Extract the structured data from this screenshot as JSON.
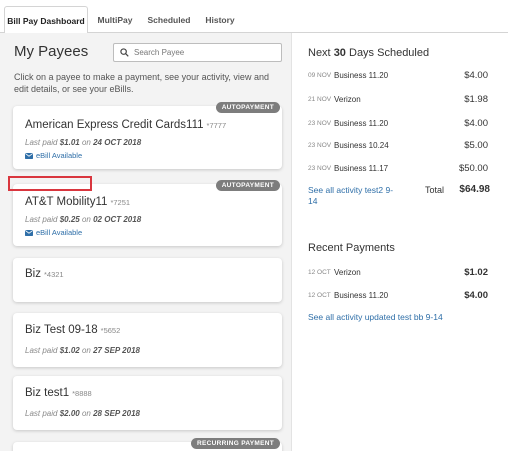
{
  "tabs": [
    {
      "label": "Bill Pay Dashboard",
      "active": true
    },
    {
      "label": "MultiPay",
      "active": false
    },
    {
      "label": "Scheduled",
      "active": false
    },
    {
      "label": "History",
      "active": false
    }
  ],
  "payees": {
    "title": "My Payees",
    "search_placeholder": "Search Payee",
    "intro": "Click on a payee to make a payment, see your activity, view and edit details, or see your eBills.",
    "cards": [
      {
        "name": "American Express Credit Cards111",
        "acct": "*7777",
        "badge": "AUTOPAYMENT",
        "last_paid_prefix": "Last paid",
        "amount": "$1.01",
        "on": "on",
        "date": "24 OCT 2018",
        "ebill": "eBill Available"
      },
      {
        "name": "AT&T Mobility11",
        "acct": "*7251",
        "badge": "AUTOPAYMENT",
        "last_paid_prefix": "Last paid",
        "amount": "$0.25",
        "on": "on",
        "date": "02 OCT 2018",
        "ebill": "eBill Available"
      },
      {
        "name": "Biz",
        "acct": "*4321"
      },
      {
        "name": "Biz Test 09-18",
        "acct": "*5652",
        "last_paid_prefix": "Last paid",
        "amount": "$1.02",
        "on": "on",
        "date": "27 SEP 2018"
      },
      {
        "name": "Biz test1",
        "acct": "*8888",
        "last_paid_prefix": "Last paid",
        "amount": "$2.00",
        "on": "on",
        "date": "28 SEP 2018"
      },
      {
        "badge": "RECURRING PAYMENT"
      }
    ]
  },
  "scheduled": {
    "title_prefix": "Next",
    "title_bold": "30",
    "title_suffix": "Days Scheduled",
    "rows": [
      {
        "date": "09 NOV",
        "name": "Business 11.20",
        "amount": "$4.00"
      },
      {
        "date": "21 NOV",
        "name": "Verizon",
        "amount": "$1.98"
      },
      {
        "date": "23 NOV",
        "name": "Business 11.20",
        "amount": "$4.00"
      },
      {
        "date": "23 NOV",
        "name": "Business 10.24",
        "amount": "$5.00"
      },
      {
        "date": "23 NOV",
        "name": "Business 11.17",
        "amount": "$50.00"
      }
    ],
    "link": "See all activity test2 9-14",
    "total_label": "Total",
    "total_amount": "$64.98"
  },
  "recent": {
    "title": "Recent Payments",
    "rows": [
      {
        "date": "12 OCT",
        "name": "Verizon",
        "amount": "$1.02"
      },
      {
        "date": "12 OCT",
        "name": "Business 11.20",
        "amount": "$4.00"
      }
    ],
    "link": "See all activity updated test bb 9-14"
  },
  "colors": {
    "accent_link": "#2f6fa8",
    "highlight_border": "#d9363e",
    "badge_bg": "#7d7d7d"
  }
}
